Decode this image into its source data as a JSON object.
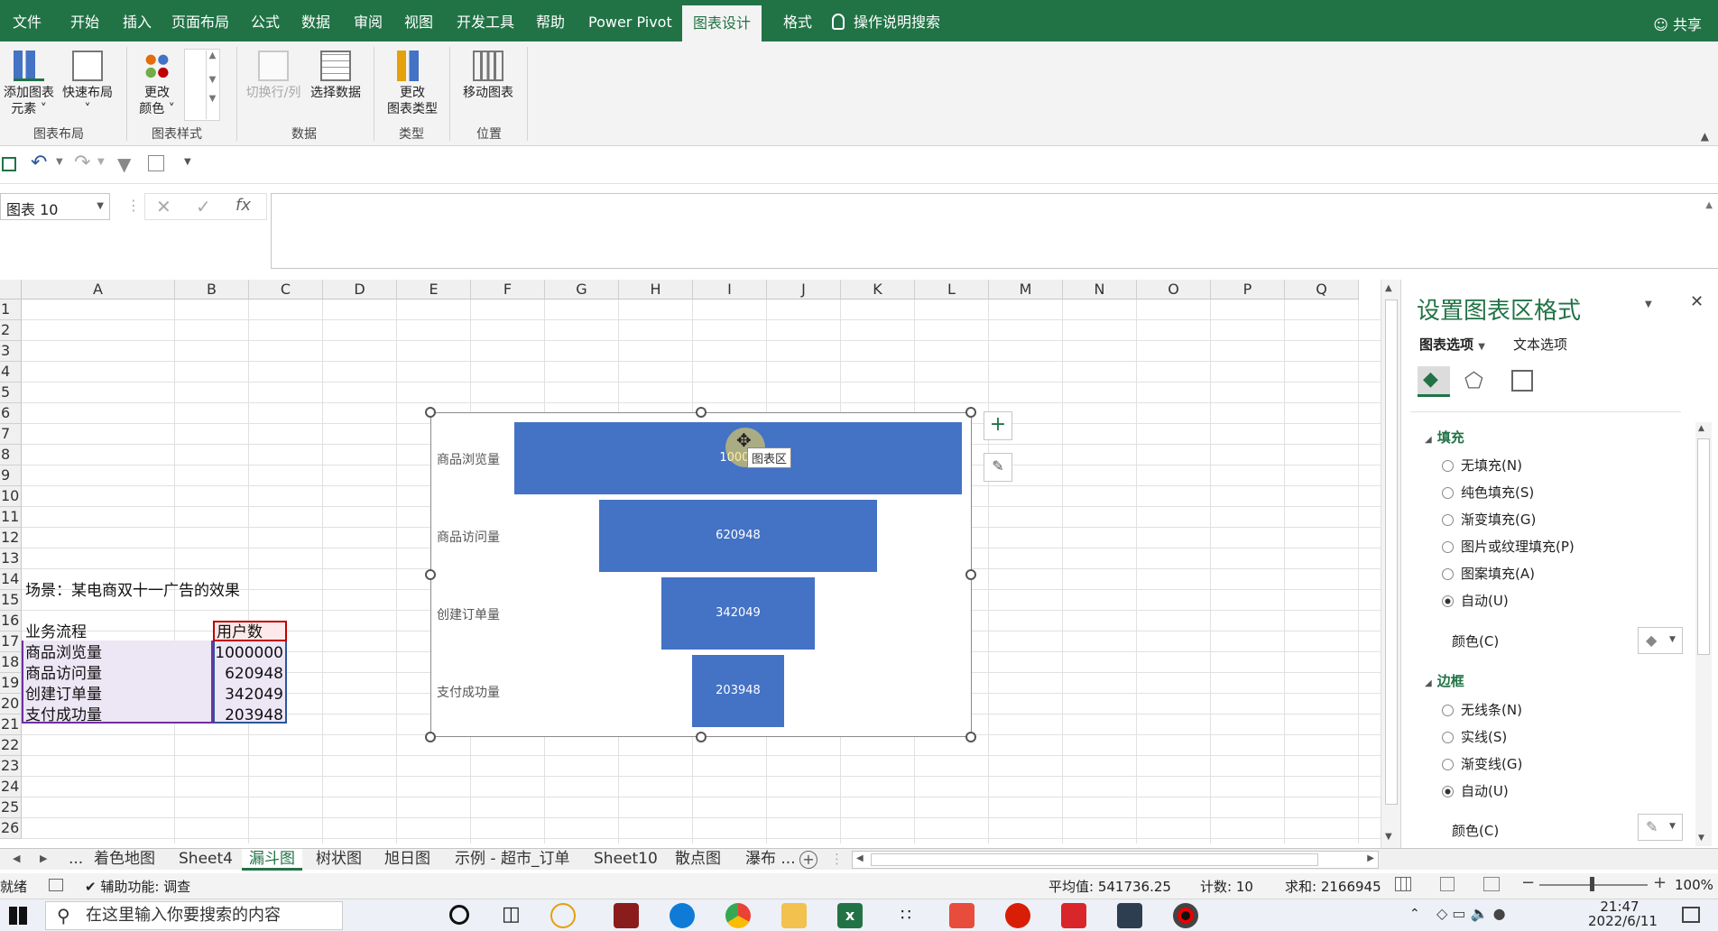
{
  "ribbon_tabs": [
    "文件",
    "开始",
    "插入",
    "页面布局",
    "公式",
    "数据",
    "审阅",
    "视图",
    "开发工具",
    "帮助",
    "Power Pivot",
    "图表设计",
    "格式"
  ],
  "active_tab": "图表设计",
  "tell_me": "操作说明搜索",
  "share": "共享",
  "ribbon": {
    "add_element": "添加图表\n元素 ˅",
    "quick_layout": "快速布局\n˅",
    "change_color": "更改\n颜色 ˅",
    "switch_row_col": "切换行/列",
    "select_data": "选择数据",
    "change_type": "更改\n图表类型",
    "move_chart": "移动图表",
    "group_layout": "图表布局",
    "group_styles": "图表样式",
    "group_data": "数据",
    "group_type": "类型",
    "group_location": "位置"
  },
  "namebox": "图表 10",
  "fx": "fx",
  "columns": [
    "A",
    "B",
    "C",
    "D",
    "E",
    "F",
    "G",
    "H",
    "I",
    "J",
    "K",
    "L",
    "M",
    "N",
    "O",
    "P",
    "Q"
  ],
  "rows": [
    "1",
    "2",
    "3",
    "4",
    "5",
    "6",
    "7",
    "8",
    "9",
    "10",
    "11",
    "12",
    "13",
    "14",
    "15",
    "16",
    "17",
    "18",
    "19",
    "20",
    "21",
    "22",
    "23",
    "24",
    "25",
    "26"
  ],
  "cells": {
    "a1": "场景：某电商双十一广告的效果",
    "a3": "业务流程",
    "b3": "用户数",
    "a4": "商品浏览量",
    "b4": "1000000",
    "a5": "商品访问量",
    "b5": "620948",
    "a6": "创建订单量",
    "b6": "342049",
    "a7": "支付成功量",
    "b7": "203948"
  },
  "chart_data": {
    "type": "bar",
    "orientation": "horizontal-funnel",
    "categories": [
      "商品浏览量",
      "商品访问量",
      "创建订单量",
      "支付成功量"
    ],
    "values": [
      1000000,
      620948,
      342049,
      203948
    ],
    "data_labels": [
      "1000000",
      "620948",
      "342049",
      "203948"
    ],
    "visible_first_label": "10000",
    "color": "#4472c4"
  },
  "tooltip": "图表区",
  "pane": {
    "title": "设置图表区格式",
    "tab_chart_options": "图表选项",
    "tab_text_options": "文本选项",
    "fill_section": "填充",
    "fill_options": [
      "无填充(N)",
      "纯色填充(S)",
      "渐变填充(G)",
      "图片或纹理填充(P)",
      "图案填充(A)",
      "自动(U)"
    ],
    "fill_selected": 5,
    "color_label": "颜色(C)",
    "border_section": "边框",
    "border_options": [
      "无线条(N)",
      "实线(S)",
      "渐变线(G)",
      "自动(U)"
    ],
    "border_selected": 3,
    "border_color_label": "颜色(C)"
  },
  "sheet_tabs": [
    "...",
    "着色地图",
    "Sheet4",
    "漏斗图",
    "树状图",
    "旭日图",
    "示例 - 超市_订单",
    "Sheet10",
    "散点图",
    "瀑布 ..."
  ],
  "active_sheet": "漏斗图",
  "status": {
    "ready": "就绪",
    "accessibility": "辅助功能: 调查",
    "average": "平均值: 541736.25",
    "count": "计数: 10",
    "sum": "求和: 2166945",
    "zoom": "100%"
  },
  "taskbar": {
    "search_placeholder": "在这里输入你要搜索的内容",
    "time": "21:47",
    "date": "2022/6/11"
  },
  "colors": {
    "excel_green": "#217346",
    "bar_blue": "#4472c4",
    "selection_purple": "#7030a0",
    "selection_red": "#c00000"
  }
}
